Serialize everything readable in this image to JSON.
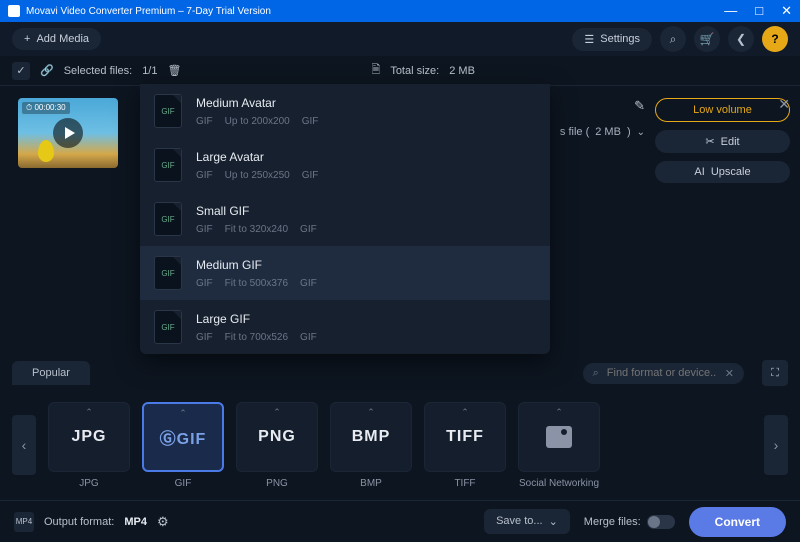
{
  "title": "Movavi Video Converter Premium – 7-Day Trial Version",
  "toolbar": {
    "add_media": "Add Media",
    "settings": "Settings"
  },
  "status": {
    "selected_label": "Selected files:",
    "selected_count": "1/1",
    "total_size_label": "Total size:",
    "total_size": "2 MB"
  },
  "thumbnail": {
    "duration": "00:00:30"
  },
  "compress": {
    "prefix": "s file (",
    "size": "2 MB",
    "suffix": ")"
  },
  "actions": {
    "low_volume": "Low volume",
    "edit": "Edit",
    "upscale": "Upscale"
  },
  "dropdown": {
    "items": [
      {
        "name": "Medium Avatar",
        "type": "GIF",
        "dim": "Up to 200x200",
        "ext": "GIF"
      },
      {
        "name": "Large Avatar",
        "type": "GIF",
        "dim": "Up to 250x250",
        "ext": "GIF"
      },
      {
        "name": "Small GIF",
        "type": "GIF",
        "dim": "Fit to 320x240",
        "ext": "GIF"
      },
      {
        "name": "Medium GIF",
        "type": "GIF",
        "dim": "Fit to 500x376",
        "ext": "GIF"
      },
      {
        "name": "Large GIF",
        "type": "GIF",
        "dim": "Fit to 700x526",
        "ext": "GIF"
      }
    ],
    "file_badge": "GIF"
  },
  "tabs": {
    "popular": "Popular"
  },
  "search": {
    "placeholder": "Find format or device..."
  },
  "formats": [
    {
      "label": "JPG",
      "caption": "JPG"
    },
    {
      "label": "GIF",
      "caption": "GIF"
    },
    {
      "label": "PNG",
      "caption": "PNG"
    },
    {
      "label": "BMP",
      "caption": "BMP"
    },
    {
      "label": "TIFF",
      "caption": "TIFF"
    },
    {
      "label": "",
      "caption": "Social Networking"
    }
  ],
  "footer": {
    "output_label": "Output format:",
    "output_value": "MP4",
    "save_to": "Save to...",
    "merge": "Merge files:",
    "convert": "Convert",
    "badge": "MP4"
  }
}
